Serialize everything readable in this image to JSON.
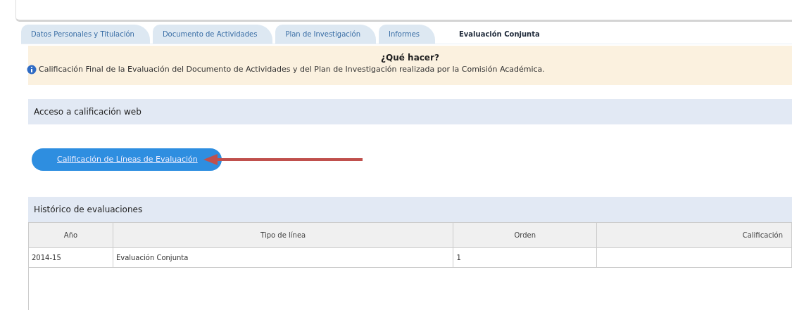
{
  "tabs": [
    {
      "label": "Datos Personales y Titulación",
      "selected": false
    },
    {
      "label": "Documento de Actividades",
      "selected": false
    },
    {
      "label": "Plan de Investigación",
      "selected": false
    },
    {
      "label": "Informes",
      "selected": false
    },
    {
      "label": "Evaluación Conjunta",
      "selected": true
    }
  ],
  "info": {
    "title": "¿Qué hacer?",
    "text": "Calificación Final de la Evaluación del Documento de Actividades y del Plan de Investigación realizada por la Comisión Académica."
  },
  "access_section": {
    "title": "Acceso a calificación web",
    "button": "Calificación de Líneas de Evaluación"
  },
  "history": {
    "title": "Histórico de evaluaciones",
    "columns": [
      "Año",
      "Tipo de línea",
      "Orden",
      "Calificación"
    ],
    "rows": [
      [
        "2014-15",
        "Evaluación Conjunta",
        "1",
        ""
      ]
    ]
  }
}
